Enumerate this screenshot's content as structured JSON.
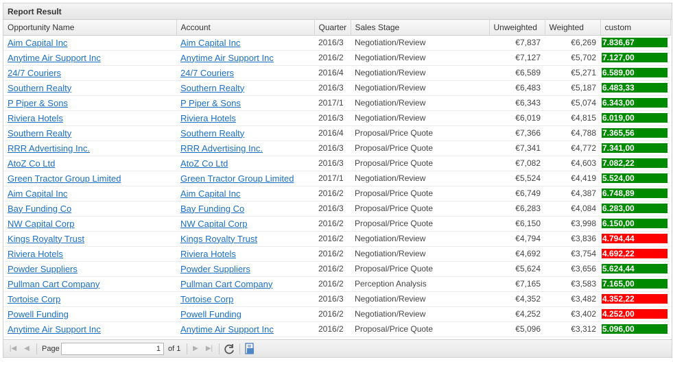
{
  "panel": {
    "title": "Report Result"
  },
  "columns": [
    "Opportunity Name",
    "Account",
    "Quarter",
    "Sales Stage",
    "Unweighted",
    "Weighted",
    "custom"
  ],
  "rows": [
    {
      "name": "Aim Capital Inc",
      "account": "Aim Capital Inc",
      "quarter": "2016/3",
      "stage": "Negotiation/Review",
      "unweighted": "€7,837",
      "weighted": "€6,269",
      "custom": "7.836,67",
      "status": "green"
    },
    {
      "name": "Anytime Air Support Inc",
      "account": "Anytime Air Support Inc",
      "quarter": "2016/2",
      "stage": "Negotiation/Review",
      "unweighted": "€7,127",
      "weighted": "€5,702",
      "custom": "7.127,00",
      "status": "green"
    },
    {
      "name": "24/7 Couriers",
      "account": "24/7 Couriers",
      "quarter": "2016/4",
      "stage": "Negotiation/Review",
      "unweighted": "€6,589",
      "weighted": "€5,271",
      "custom": "6.589,00",
      "status": "green"
    },
    {
      "name": "Southern Realty",
      "account": "Southern Realty",
      "quarter": "2016/3",
      "stage": "Negotiation/Review",
      "unweighted": "€6,483",
      "weighted": "€5,187",
      "custom": "6.483,33",
      "status": "green"
    },
    {
      "name": "P Piper & Sons",
      "account": "P Piper & Sons",
      "quarter": "2017/1",
      "stage": "Negotiation/Review",
      "unweighted": "€6,343",
      "weighted": "€5,074",
      "custom": "6.343,00",
      "status": "green"
    },
    {
      "name": "Riviera Hotels",
      "account": "Riviera Hotels",
      "quarter": "2016/3",
      "stage": "Negotiation/Review",
      "unweighted": "€6,019",
      "weighted": "€4,815",
      "custom": "6.019,00",
      "status": "green"
    },
    {
      "name": "Southern Realty",
      "account": "Southern Realty",
      "quarter": "2016/4",
      "stage": "Proposal/Price Quote",
      "unweighted": "€7,366",
      "weighted": "€4,788",
      "custom": "7.365,56",
      "status": "green"
    },
    {
      "name": "RRR Advertising Inc.",
      "account": "RRR Advertising Inc.",
      "quarter": "2016/3",
      "stage": "Proposal/Price Quote",
      "unweighted": "€7,341",
      "weighted": "€4,772",
      "custom": "7.341,00",
      "status": "green"
    },
    {
      "name": "AtoZ Co Ltd",
      "account": "AtoZ Co Ltd",
      "quarter": "2016/3",
      "stage": "Proposal/Price Quote",
      "unweighted": "€7,082",
      "weighted": "€4,603",
      "custom": "7.082,22",
      "status": "green"
    },
    {
      "name": "Green Tractor Group Limited",
      "account": "Green Tractor Group Limited",
      "quarter": "2017/1",
      "stage": "Negotiation/Review",
      "unweighted": "€5,524",
      "weighted": "€4,419",
      "custom": "5.524,00",
      "status": "green"
    },
    {
      "name": "Aim Capital Inc",
      "account": "Aim Capital Inc",
      "quarter": "2016/2",
      "stage": "Proposal/Price Quote",
      "unweighted": "€6,749",
      "weighted": "€4,387",
      "custom": "6.748,89",
      "status": "green"
    },
    {
      "name": "Bay Funding Co",
      "account": "Bay Funding Co",
      "quarter": "2016/3",
      "stage": "Proposal/Price Quote",
      "unweighted": "€6,283",
      "weighted": "€4,084",
      "custom": "6.283,00",
      "status": "green"
    },
    {
      "name": "NW Capital Corp",
      "account": "NW Capital Corp",
      "quarter": "2016/2",
      "stage": "Proposal/Price Quote",
      "unweighted": "€6,150",
      "weighted": "€3,998",
      "custom": "6.150,00",
      "status": "green"
    },
    {
      "name": "Kings Royalty Trust",
      "account": "Kings Royalty Trust",
      "quarter": "2016/2",
      "stage": "Negotiation/Review",
      "unweighted": "€4,794",
      "weighted": "€3,836",
      "custom": "4.794,44",
      "status": "red"
    },
    {
      "name": "Riviera Hotels",
      "account": "Riviera Hotels",
      "quarter": "2016/2",
      "stage": "Negotiation/Review",
      "unweighted": "€4,692",
      "weighted": "€3,754",
      "custom": "4.692,22",
      "status": "red"
    },
    {
      "name": "Powder Suppliers",
      "account": "Powder Suppliers",
      "quarter": "2016/2",
      "stage": "Proposal/Price Quote",
      "unweighted": "€5,624",
      "weighted": "€3,656",
      "custom": "5.624,44",
      "status": "green"
    },
    {
      "name": "Pullman Cart Company",
      "account": "Pullman Cart Company",
      "quarter": "2016/2",
      "stage": "Perception Analysis",
      "unweighted": "€7,165",
      "weighted": "€3,583",
      "custom": "7.165,00",
      "status": "green"
    },
    {
      "name": "Tortoise Corp",
      "account": "Tortoise Corp",
      "quarter": "2016/3",
      "stage": "Negotiation/Review",
      "unweighted": "€4,352",
      "weighted": "€3,482",
      "custom": "4.352,22",
      "status": "red"
    },
    {
      "name": "Powell Funding",
      "account": "Powell Funding",
      "quarter": "2016/2",
      "stage": "Negotiation/Review",
      "unweighted": "€4,252",
      "weighted": "€3,402",
      "custom": "4.252,00",
      "status": "red"
    },
    {
      "name": "Anytime Air Support Inc",
      "account": "Anytime Air Support Inc",
      "quarter": "2016/2",
      "stage": "Proposal/Price Quote",
      "unweighted": "€5,096",
      "weighted": "€3,312",
      "custom": "5.096,00",
      "status": "green"
    }
  ],
  "colors": {
    "green": "#008a00",
    "red": "#ff0000",
    "link": "#1a6fc4"
  },
  "pager": {
    "page_label": "Page",
    "page_value": "1",
    "of_label": "of 1",
    "icons": [
      "first-page-icon",
      "prev-page-icon",
      "next-page-icon",
      "last-page-icon",
      "refresh-icon",
      "export-icon"
    ]
  }
}
